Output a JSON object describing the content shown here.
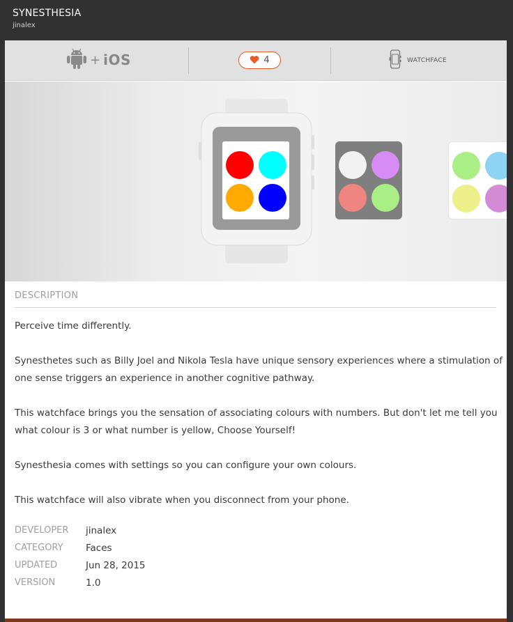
{
  "header": {
    "title": "SYNESTHESIA",
    "author": "jinalex"
  },
  "infobar": {
    "platform_plus": "+",
    "platform_ios": "iOS",
    "hearts_count": "4",
    "type_label": "WATCHFACE",
    "icons": [
      "android-icon",
      "heart-icon",
      "watch-icon"
    ],
    "accent_color": "#e85b26"
  },
  "gallery": {
    "screenshots": [
      {
        "background": "#ffffff",
        "dots": [
          "#ff0000",
          "#00ffff",
          "#ffaa00",
          "#0000ff"
        ]
      },
      {
        "background": "#7f7f7f",
        "dots": [
          "#f2f2f2",
          "#d78cf5",
          "#ef8580",
          "#a9ef86"
        ]
      },
      {
        "background": "#ffffff",
        "dots": [
          "#a9ef86",
          "#8fd3f4",
          "#eef08a",
          "#d48bd6"
        ]
      }
    ]
  },
  "description": {
    "heading": "DESCRIPTION",
    "paragraphs": [
      "Perceive time differently.",
      "Synesthetes such as Billy Joel and Nikola Tesla have unique sensory experiences where a stimulation of one sense triggers an experience in another cognitive pathway.",
      "This watchface brings you the sensation of associating colours with numbers. But don't let me tell you what colour is 3 or what number is yellow, Choose Yourself!",
      "Synesthesia comes with settings so you can configure your own colours.",
      "This watchface will also vibrate when you disconnect from your phone."
    ]
  },
  "meta": {
    "developer_label": "DEVELOPER",
    "developer_value": "jinalex",
    "category_label": "CATEGORY",
    "category_value": "Faces",
    "updated_label": "UPDATED",
    "updated_value": "Jun 28, 2015",
    "version_label": "VERSION",
    "version_value": "1.0"
  }
}
